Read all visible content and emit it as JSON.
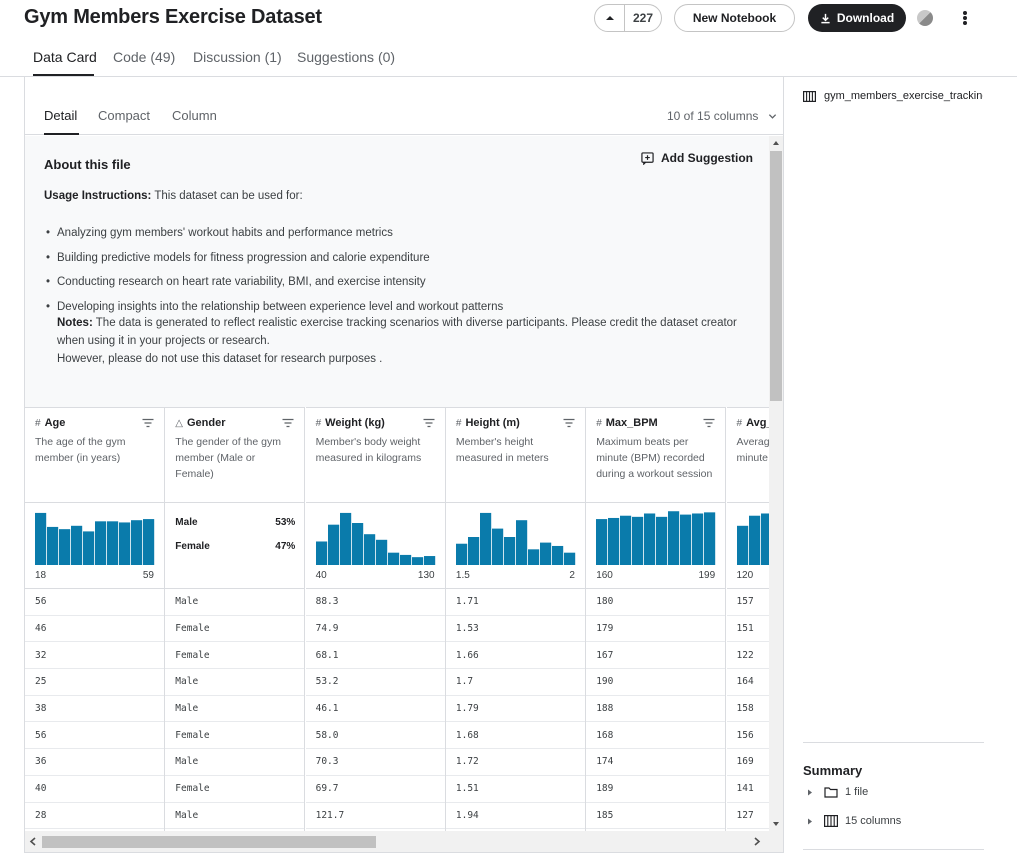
{
  "header": {
    "title": "Gym Members Exercise Dataset",
    "upvotes": "227",
    "new_notebook": "New Notebook",
    "download": "Download"
  },
  "main_tabs": [
    "Data Card",
    "Code (49)",
    "Discussion (1)",
    "Suggestions (0)"
  ],
  "sub_tabs": [
    "Detail",
    "Compact",
    "Column"
  ],
  "columns_selector": "10 of 15 columns",
  "about": {
    "title": "About this file",
    "add_suggestion": "Add Suggestion",
    "usage_label": "Usage Instructions:",
    "usage_text": " This dataset can be used for:",
    "bullets": [
      "Analyzing gym members' workout habits and performance metrics",
      "Building predictive models for fitness progression and calorie expenditure",
      "Conducting research on heart rate variability, BMI, and exercise intensity",
      "Developing insights into the relationship between experience level and workout patterns"
    ],
    "notes_label": "Notes:",
    "notes_text": " The data is generated to reflect realistic exercise tracking scenarios with diverse participants. Please credit the dataset creator when using it in your projects or research.",
    "notes_line2": "However, please do not use this dataset for research purposes ."
  },
  "table": {
    "columns": [
      {
        "type_icon": "#",
        "name": "Age",
        "desc": "The age of the gym member (in years)",
        "min": "18",
        "max": "59",
        "hist": [
          0.93,
          0.68,
          0.64,
          0.7,
          0.6,
          0.78,
          0.78,
          0.76,
          0.8,
          0.82
        ]
      },
      {
        "type_icon": "A",
        "name": "Gender",
        "desc": "The gender of the gym member (Male or Female)",
        "categories": [
          {
            "label": "Male",
            "pct": "53%"
          },
          {
            "label": "Female",
            "pct": "47%"
          }
        ]
      },
      {
        "type_icon": "#",
        "name": "Weight (kg)",
        "desc": "Member's body weight measured in kilograms",
        "min": "40",
        "max": "130",
        "hist": [
          0.42,
          0.72,
          0.93,
          0.75,
          0.55,
          0.45,
          0.22,
          0.18,
          0.14,
          0.16
        ]
      },
      {
        "type_icon": "#",
        "name": "Height (m)",
        "desc": "Member's height measured in meters",
        "min": "1.5",
        "max": "2",
        "hist": [
          0.38,
          0.5,
          0.93,
          0.65,
          0.5,
          0.8,
          0.28,
          0.4,
          0.34,
          0.22
        ]
      },
      {
        "type_icon": "#",
        "name": "Max_BPM",
        "desc": "Maximum beats per minute (BPM) recorded during a workout session",
        "min": "160",
        "max": "199",
        "hist": [
          0.82,
          0.84,
          0.88,
          0.86,
          0.92,
          0.86,
          0.96,
          0.9,
          0.92,
          0.94
        ]
      },
      {
        "type_icon": "#",
        "name": "Avg_BPM",
        "desc": "Average beats per minute during workout",
        "min": "120",
        "max": "",
        "hist": [
          0.7,
          0.88,
          0.92,
          0.85,
          0.8,
          0.88,
          0.9,
          0.85,
          0.82,
          0.86
        ]
      }
    ],
    "rows": [
      [
        "56",
        "Male",
        "88.3",
        "1.71",
        "180",
        "157"
      ],
      [
        "46",
        "Female",
        "74.9",
        "1.53",
        "179",
        "151"
      ],
      [
        "32",
        "Female",
        "68.1",
        "1.66",
        "167",
        "122"
      ],
      [
        "25",
        "Male",
        "53.2",
        "1.7",
        "190",
        "164"
      ],
      [
        "38",
        "Male",
        "46.1",
        "1.79",
        "188",
        "158"
      ],
      [
        "56",
        "Female",
        "58.0",
        "1.68",
        "168",
        "156"
      ],
      [
        "36",
        "Male",
        "70.3",
        "1.72",
        "174",
        "169"
      ],
      [
        "40",
        "Female",
        "69.7",
        "1.51",
        "189",
        "141"
      ],
      [
        "28",
        "Male",
        "121.7",
        "1.94",
        "185",
        "127"
      ]
    ]
  },
  "sidebar": {
    "file_name": "gym_members_exercise_tracking.csv",
    "summary_title": "Summary",
    "files": "1 file",
    "columns": "15 columns"
  },
  "colors": {
    "bar": "#0a7bab",
    "dark_button": "#202124"
  }
}
